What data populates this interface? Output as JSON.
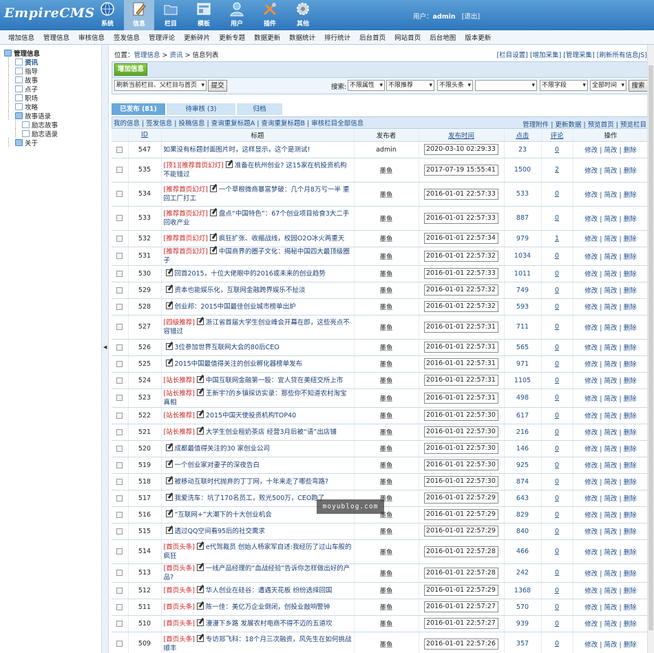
{
  "app": {
    "logo": "EmpireCMS",
    "user_label": "用户：",
    "user_name": "admin",
    "logout": "[退出]"
  },
  "nav": [
    {
      "label": "系统",
      "icon": "globe-icon"
    },
    {
      "label": "信息",
      "icon": "edit-icon",
      "active": true
    },
    {
      "label": "栏目",
      "icon": "folder-icon"
    },
    {
      "label": "模板",
      "icon": "template-icon"
    },
    {
      "label": "用户",
      "icon": "user-icon"
    },
    {
      "label": "插件",
      "icon": "tools-icon"
    },
    {
      "label": "其他",
      "icon": "gear-icon"
    }
  ],
  "submenu": [
    "增加信息",
    "管理信息",
    "审核信息",
    "签发信息",
    "管理评论",
    "更新碎片",
    "更新专题",
    "数据更新",
    "数据统计",
    "排行统计",
    "后台首页",
    "网站首页",
    "后台地图",
    "版本更新"
  ],
  "sidebar": {
    "root": "管理信息",
    "items": [
      {
        "label": "资讯",
        "active": true
      },
      {
        "label": "指导"
      },
      {
        "label": "故事"
      },
      {
        "label": "点子"
      },
      {
        "label": "职场"
      },
      {
        "label": "攻略"
      },
      {
        "label": "故事语录",
        "folder": true
      },
      {
        "label": "励志故事",
        "sub": true
      },
      {
        "label": "励志语录",
        "sub": true
      },
      {
        "label": "关于",
        "folder": true
      }
    ]
  },
  "location": {
    "label": "位置：",
    "crumbs": [
      "管理信息",
      " > ",
      "资讯",
      " > ",
      "信息列表"
    ]
  },
  "toplinks": "[栏目设置] [增加采集] [管理采集] [刷新所有信息JS]",
  "add_button": "增加信息",
  "filter": {
    "refresh_select": "刷新当前栏目、父栏目与首页",
    "submit": "提交",
    "search_label": "搜索:",
    "attr": "不限属性",
    "recommend": "不限推荐",
    "headline": "不限头条",
    "field": "不限字段",
    "time": "全部时间",
    "search_button": "搜索",
    "keyword": ""
  },
  "tabs": [
    "已发布 (81)",
    "待审核 (3)",
    "归档"
  ],
  "headbar": {
    "left": "我的信息 | 签发信息 | 投稿信息 | 查询重复标题A | 查询重复标题B | 审核栏目全部信息",
    "right": "管理附件 | 更新数据 | 预览首页 | 预览栏目"
  },
  "columns": {
    "id": "ID",
    "title": "标题",
    "publisher": "发布者",
    "time": "发布时间",
    "clicks": "点击",
    "comments": "评论",
    "ops": "操作"
  },
  "ops_text": "修改 | 简改 | 删除",
  "watermark": "moyublog.com",
  "rows": [
    {
      "id": "547",
      "flag": "",
      "title": "如果没有标题封面图片时，这样显示，这个是测试!",
      "pub": "admin",
      "time": "2020-03-10 02:29:33",
      "clicks": "23",
      "comments": "0",
      "pen": false,
      "tall": false
    },
    {
      "id": "535",
      "flag": "[顶1][推荐首页幻灯]",
      "title": "准备在杭州创业? 这15家在杭投资机构不能错过",
      "pub": "墨鱼",
      "time": "2017-07-19 15:55:41",
      "clicks": "1500",
      "comments": "2",
      "pen": true,
      "tall": true
    },
    {
      "id": "534",
      "flag": "[推荐首页幻灯]",
      "title": "一个草根微商暴富梦破：几个月8万亏一半 重回工厂打工",
      "pub": "墨鱼",
      "time": "2016-01-01 22:57:33",
      "clicks": "533",
      "comments": "0",
      "pen": true,
      "tall": true
    },
    {
      "id": "533",
      "flag": "[推荐首页幻灯]",
      "title": "盘点“中国特色”：67个创业项目拾食3大二手回收产业",
      "pub": "墨鱼",
      "time": "2016-01-01 22:57:33",
      "clicks": "887",
      "comments": "0",
      "pen": true,
      "tall": true
    },
    {
      "id": "532",
      "flag": "[推荐首页幻灯]",
      "title": "疯狂扩张、收缩战线，校园O2O冰火两重天",
      "pub": "墨鱼",
      "time": "2016-01-01 22:57:34",
      "clicks": "979",
      "comments": "1",
      "pen": true,
      "tall": false
    },
    {
      "id": "531",
      "flag": "[推荐首页幻灯]",
      "title": "中国商界的圈子文化：揭秘中国四大最顶级圈子",
      "pub": "墨鱼",
      "time": "2016-01-01 22:57:32",
      "clicks": "1034",
      "comments": "0",
      "pen": true,
      "tall": false
    },
    {
      "id": "530",
      "flag": "",
      "title": "回首2015，十位大佬眼中的2016或未来的创业趋势",
      "pub": "墨鱼",
      "time": "2016-01-01 22:57:33",
      "clicks": "1011",
      "comments": "0",
      "pen": true,
      "tall": false
    },
    {
      "id": "529",
      "flag": "",
      "title": "资本也能娱乐化，互联网金融跨界娱乐不扯淡",
      "pub": "墨鱼",
      "time": "2016-01-01 22:57:32",
      "clicks": "749",
      "comments": "0",
      "pen": true,
      "tall": false
    },
    {
      "id": "528",
      "flag": "",
      "title": "创业邦：2015中国最佳创业城市榜单出炉",
      "pub": "墨鱼",
      "time": "2016-01-01 22:57:32",
      "clicks": "593",
      "comments": "0",
      "pen": true,
      "tall": false
    },
    {
      "id": "527",
      "flag": "[四级推荐]",
      "title": "浙江省首届大学生创业峰会开幕在即，这些亮点不容错过",
      "pub": "墨鱼",
      "time": "2016-01-01 22:57:31",
      "clicks": "711",
      "comments": "0",
      "pen": true,
      "tall": true
    },
    {
      "id": "526",
      "flag": "",
      "title": "3位参加世界互联网大会的80后CEO",
      "pub": "墨鱼",
      "time": "2016-01-01 22:57:31",
      "clicks": "565",
      "comments": "0",
      "pen": true,
      "tall": false
    },
    {
      "id": "525",
      "flag": "",
      "title": "2015中国最值得关注的创业孵化器榜单发布",
      "pub": "墨鱼",
      "time": "2016-01-01 22:57:31",
      "clicks": "971",
      "comments": "0",
      "pen": true,
      "tall": false
    },
    {
      "id": "524",
      "flag": "[站长推荐]",
      "title": "中国互联网金融第一股：宜人贷在美纽交所上市",
      "pub": "墨鱼",
      "time": "2016-01-01 22:57:31",
      "clicks": "1105",
      "comments": "0",
      "pen": true,
      "tall": false
    },
    {
      "id": "523",
      "flag": "[站长推荐]",
      "title": "王新宇?的乡镇探访实录：那些你不知道农村淘宝真相",
      "pub": "墨鱼",
      "time": "2016-01-01 22:57:31",
      "clicks": "498",
      "comments": "0",
      "pen": true,
      "tall": false
    },
    {
      "id": "522",
      "flag": "[站长推荐]",
      "title": "2015中国天使投资机构TOP40",
      "pub": "墨鱼",
      "time": "2016-01-01 22:57:30",
      "clicks": "617",
      "comments": "0",
      "pen": true,
      "tall": false
    },
    {
      "id": "521",
      "flag": "[站长推荐]",
      "title": "大学生创业租奶茶店 经营3月后被“请”出店铺",
      "pub": "墨鱼",
      "time": "2016-01-01 22:57:30",
      "clicks": "216",
      "comments": "0",
      "pen": true,
      "tall": false
    },
    {
      "id": "520",
      "flag": "",
      "title": "成都最值得关注的30 家创业公司",
      "pub": "墨鱼",
      "time": "2016-01-01 22:57:30",
      "clicks": "146",
      "comments": "0",
      "pen": true,
      "tall": false
    },
    {
      "id": "519",
      "flag": "",
      "title": "一个创业家对妻子的深夜告白",
      "pub": "墨鱼",
      "time": "2016-01-01 22:57:30",
      "clicks": "925",
      "comments": "0",
      "pen": true,
      "tall": false
    },
    {
      "id": "518",
      "flag": "",
      "title": "被移动互联时代抛弃的丁丁网，十年来走了哪些弯路?",
      "pub": "墨鱼",
      "time": "2016-01-01 22:57:30",
      "clicks": "874",
      "comments": "0",
      "pen": true,
      "tall": false
    },
    {
      "id": "517",
      "flag": "",
      "title": "我爱洗车：坑了170名员工，败光500万，CEO跑了",
      "pub": "墨鱼",
      "time": "2016-01-01 22:57:29",
      "clicks": "643",
      "comments": "0",
      "pen": true,
      "tall": false
    },
    {
      "id": "516",
      "flag": "",
      "title": "“互联网+”大潮下的十大创业机会",
      "pub": "墨鱼",
      "time": "2016-01-01 22:57:29",
      "clicks": "829",
      "comments": "0",
      "pen": true,
      "tall": false
    },
    {
      "id": "515",
      "flag": "",
      "title": "透过QQ空间看95后的社交需求",
      "pub": "墨鱼",
      "time": "2016-01-01 22:57:29",
      "clicks": "840",
      "comments": "0",
      "pen": true,
      "tall": false
    },
    {
      "id": "514",
      "flag": "[首页头条]",
      "title": "e代驾裁员 创始人杨家军自述:我经历了过山车般的疯狂",
      "pub": "墨鱼",
      "time": "2016-01-01 22:57:28",
      "clicks": "466",
      "comments": "0",
      "pen": true,
      "tall": true
    },
    {
      "id": "513",
      "flag": "[首页头条]",
      "title": "一线产品经理的“血战经验”告诉你怎样做出好的产品?",
      "pub": "墨鱼",
      "time": "2016-01-01 22:57:28",
      "clicks": "242",
      "comments": "0",
      "pen": true,
      "tall": false
    },
    {
      "id": "512",
      "flag": "[首页头条]",
      "title": "华人创业在硅谷：遭遇天花板 纷纷选择回国",
      "pub": "墨鱼",
      "time": "2016-01-01 22:57:29",
      "clicks": "1368",
      "comments": "0",
      "pen": true,
      "tall": false
    },
    {
      "id": "511",
      "flag": "[首页头条]",
      "title": "陈一佳：美亿万企业倒闭，创投业敲响警钟",
      "pub": "墨鱼",
      "time": "2016-01-01 22:57:27",
      "clicks": "570",
      "comments": "0",
      "pen": true,
      "tall": false
    },
    {
      "id": "510",
      "flag": "[首页头条]",
      "title": "漫漫下乡路 发展农村电商不得不迈的五道坎",
      "pub": "墨鱼",
      "time": "2016-01-01 22:57:27",
      "clicks": "939",
      "comments": "0",
      "pen": true,
      "tall": false
    },
    {
      "id": "509",
      "flag": "[首页头条]",
      "title": "专访郑飞科：18个月三次融资，风先生在如何挑战顺丰",
      "pub": "墨鱼",
      "time": "2016-01-01 22:57:26",
      "clicks": "357",
      "comments": "0",
      "pen": true,
      "tall": true
    }
  ]
}
